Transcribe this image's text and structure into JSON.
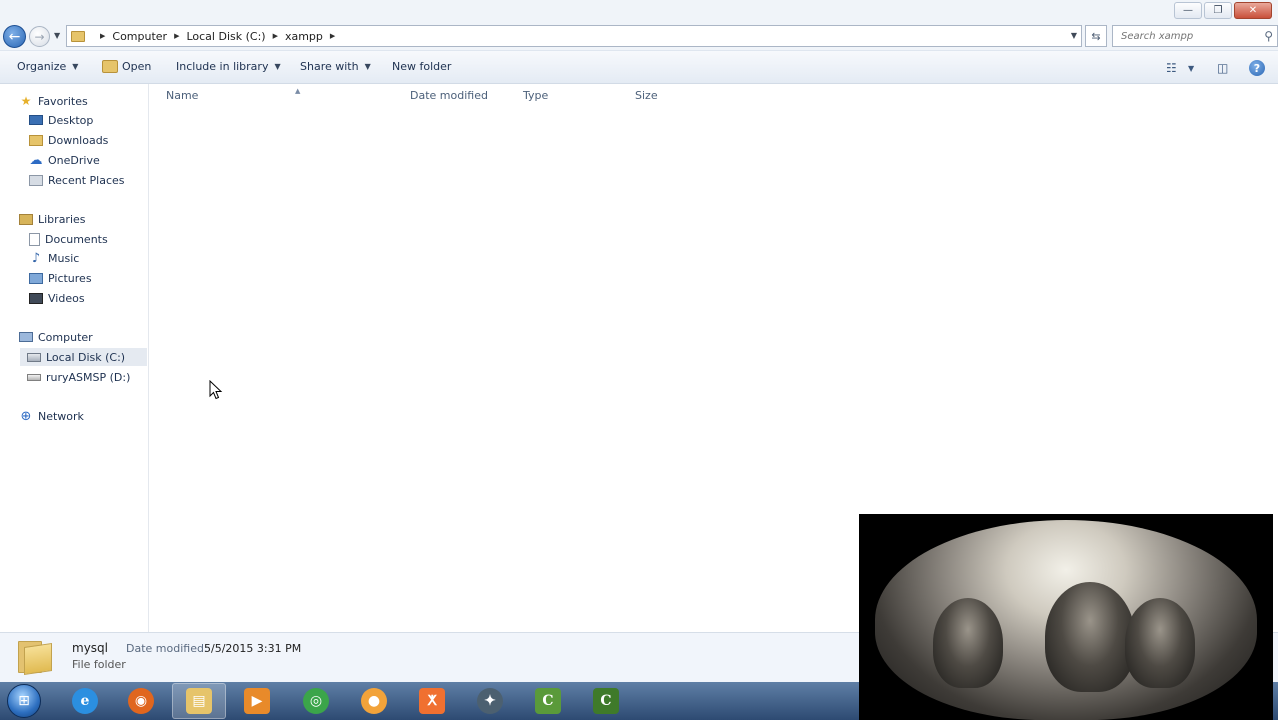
{
  "window": {
    "minimize_glyph": "—",
    "restore_glyph": "❐",
    "close_glyph": "✕"
  },
  "address_bar": {
    "back_glyph": "←",
    "breadcrumbs": [
      "Computer",
      "Local Disk (C:)",
      "xampp"
    ],
    "search_placeholder": "Search xampp",
    "search_glyph": "⚲",
    "refresh_glyph": "⇆"
  },
  "toolbar": {
    "organize": "Organize",
    "open": "Open",
    "include_in_library": "Include in library",
    "share_with": "Share with",
    "new_folder": "New folder",
    "help_glyph": "?"
  },
  "nav": {
    "favorites": "Favorites",
    "desktop": "Desktop",
    "downloads": "Downloads",
    "onedrive": "OneDrive",
    "recent_places": "Recent Places",
    "libraries": "Libraries",
    "documents": "Documents",
    "music": "Music",
    "pictures": "Pictures",
    "videos": "Videos",
    "computer": "Computer",
    "local_disk": "Local Disk (C:)",
    "drive_d": "ruryASMSP (D:)",
    "network": "Network"
  },
  "columns": {
    "name": "Name",
    "date_modified": "Date modified",
    "type": "Type",
    "size": "Size"
  },
  "details": {
    "name": "mysql",
    "type": "File folder",
    "date_label": "Date modified:",
    "date_value": "5/5/2015 3:31 PM"
  },
  "taskbar": {
    "start_glyph": "⊞",
    "apps": [
      {
        "name": "internet-explorer",
        "glyph": "e",
        "color": "#2b8fe0"
      },
      {
        "name": "firefox",
        "glyph": "◉",
        "color": "#e0661e"
      },
      {
        "name": "windows-explorer",
        "glyph": "▤",
        "color": "#e6c46a"
      },
      {
        "name": "media-player",
        "glyph": "▶",
        "color": "#e88a2a"
      },
      {
        "name": "chrome",
        "glyph": "◎",
        "color": "#3ba54a"
      },
      {
        "name": "orange-app",
        "glyph": "●",
        "color": "#f2a33a"
      },
      {
        "name": "xampp",
        "glyph": "ⵅ",
        "color": "#f07030"
      },
      {
        "name": "satellite-app",
        "glyph": "✦",
        "color": "#4c6070"
      },
      {
        "name": "camtasia-recorder",
        "glyph": "C",
        "color": "#5a9a3a"
      },
      {
        "name": "camtasia-studio",
        "glyph": "C",
        "color": "#3f7a2a"
      }
    ]
  }
}
